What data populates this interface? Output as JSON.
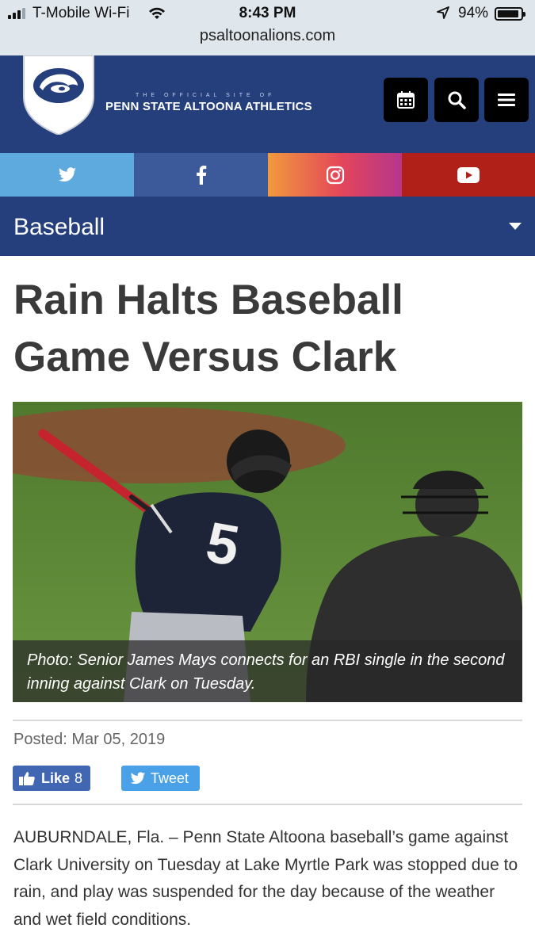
{
  "status_bar": {
    "carrier": "T-Mobile Wi-Fi",
    "time": "8:43 PM",
    "battery": "94%",
    "battery_level": 0.94,
    "url": "psaltoonalions.com"
  },
  "header": {
    "tagline": "THE OFFICIAL SITE OF",
    "site_name": "PENN STATE ALTOONA ATHLETICS",
    "buttons": [
      "calendar-icon",
      "search-icon",
      "menu-icon"
    ]
  },
  "social": {
    "items": [
      "twitter-icon",
      "facebook-icon",
      "instagram-icon",
      "youtube-icon"
    ],
    "colors": {
      "twitter": "#5ea9dd",
      "facebook": "#3c5a99",
      "instagram": "#e4455a",
      "youtube": "#b02018"
    }
  },
  "section": {
    "title": "Baseball"
  },
  "article": {
    "headline": "Rain Halts Baseball Game Versus Clark",
    "caption": "Photo: Senior James Mays connects for an RBI single in the second inning against Clark on Tuesday.",
    "posted": "Posted: Mar 05, 2019",
    "like_label": "Like",
    "like_count": "8",
    "tweet_label": "Tweet",
    "body": "AUBURNDALE, Fla. – Penn State Altoona baseball’s game against Clark University on Tuesday at Lake Myrtle Park was stopped due to rain, and play was suspended for the day because of the weather and wet field conditions."
  },
  "theme": {
    "brand_blue": "#243f7c"
  }
}
